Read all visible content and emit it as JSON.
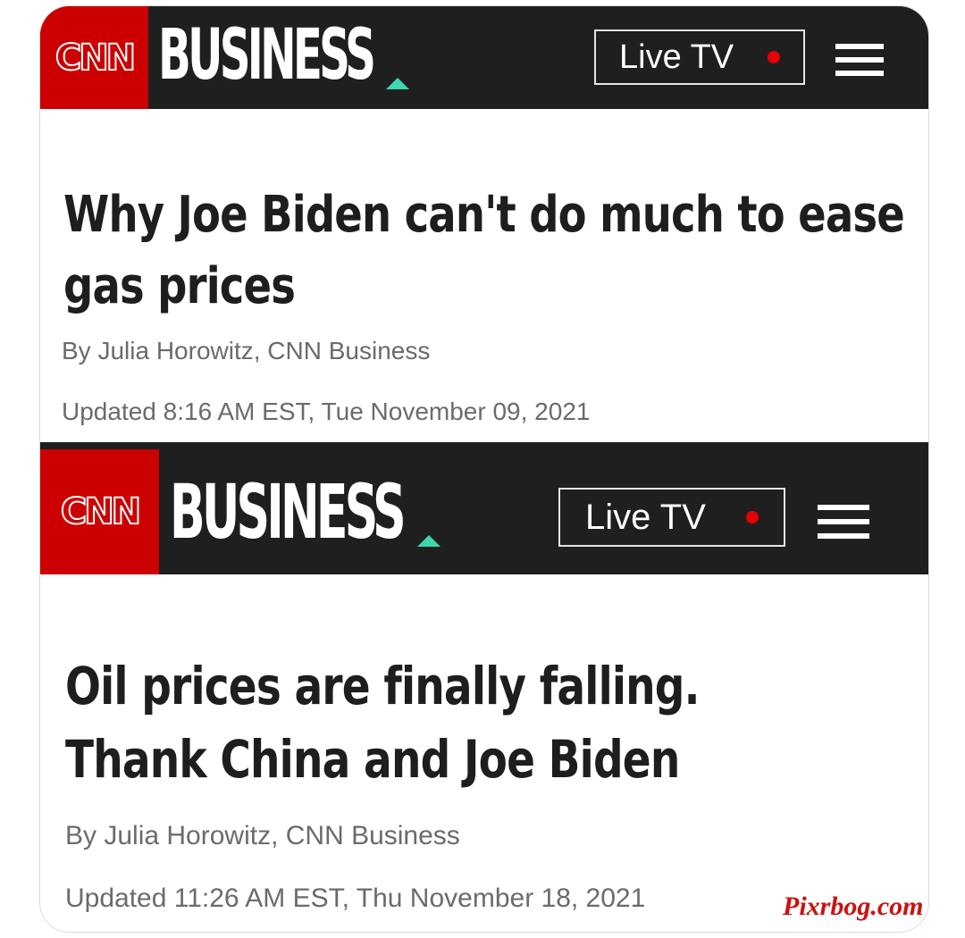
{
  "articles": [
    {
      "brand": {
        "logo": "CNN",
        "section": "BUSINESS",
        "accent_color": "#3fd6b0",
        "logo_bg": "#cc0000"
      },
      "live_tv_label": "Live TV",
      "menu_icon": "hamburger-menu-icon",
      "headline_line1": "Why Joe Biden can't do much to ease",
      "headline_line2": "gas prices",
      "byline": "By Julia Horowitz, CNN Business",
      "updated": "Updated 8:16 AM EST, Tue November 09, 2021"
    },
    {
      "brand": {
        "logo": "CNN",
        "section": "BUSINESS",
        "accent_color": "#3fd6b0",
        "logo_bg": "#cc0000"
      },
      "live_tv_label": "Live TV",
      "menu_icon": "hamburger-menu-icon",
      "headline_line1": "Oil prices are finally falling.",
      "headline_line2": "Thank China and Joe Biden",
      "byline": "By Julia Horowitz, CNN Business",
      "updated": "Updated 11:26 AM EST, Thu November 18, 2021"
    }
  ],
  "watermark": "Pixrbog.com"
}
